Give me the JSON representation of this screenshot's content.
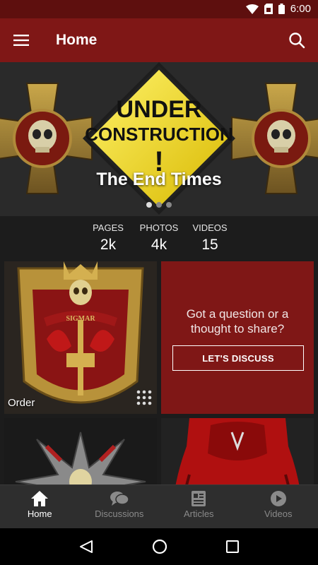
{
  "status_bar": {
    "time": "6:00"
  },
  "app_bar": {
    "title": "Home"
  },
  "hero": {
    "title": "The End Times",
    "sign_line1": "UNDER",
    "sign_line2": "CONSTRUCTION",
    "sign_mark": "!",
    "slide_count": 3,
    "active_slide": 0
  },
  "stats": [
    {
      "label": "PAGES",
      "value": "2k"
    },
    {
      "label": "PHOTOS",
      "value": "4k"
    },
    {
      "label": "VIDEOS",
      "value": "15"
    }
  ],
  "tiles": {
    "order": {
      "label": "Order",
      "banner_text": "SIGMAR"
    },
    "discuss": {
      "text": "Got a question or a thought to share?",
      "button_label": "LET'S DISCUSS"
    }
  },
  "bottom_nav": [
    {
      "label": "Home",
      "icon": "home-icon",
      "active": true
    },
    {
      "label": "Discussions",
      "icon": "discussions-icon",
      "active": false
    },
    {
      "label": "Articles",
      "icon": "articles-icon",
      "active": false
    },
    {
      "label": "Videos",
      "icon": "videos-icon",
      "active": false
    }
  ],
  "colors": {
    "status_bar": "#5e0f0e",
    "app_bar": "#7f1716",
    "accent": "#7f1716",
    "nav_bg": "#2e2e2e"
  }
}
